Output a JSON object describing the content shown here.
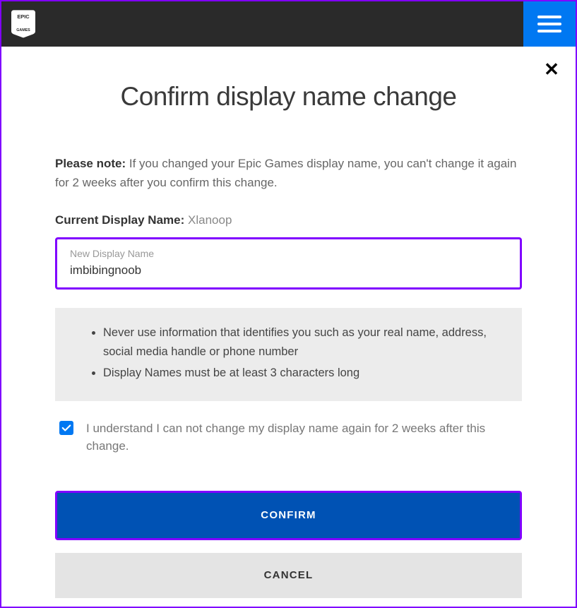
{
  "header": {
    "logo_text": "EPIC GAMES"
  },
  "modal": {
    "title": "Confirm display name change",
    "note_label": "Please note:",
    "note_text": "If you changed your Epic Games display name, you can't change it again for 2 weeks after you confirm this change.",
    "current_label": "Current Display Name:",
    "current_value": "Xlanoop",
    "input_label": "New Display Name",
    "input_value": "imbibingnoob",
    "rules": [
      "Never use information that identifies you such as your real name, address, social media handle or phone number",
      "Display Names must be at least 3 characters long"
    ],
    "checkbox_label": "I understand I can not change my display name again for 2 weeks after this change.",
    "confirm_label": "CONFIRM",
    "cancel_label": "CANCEL"
  }
}
